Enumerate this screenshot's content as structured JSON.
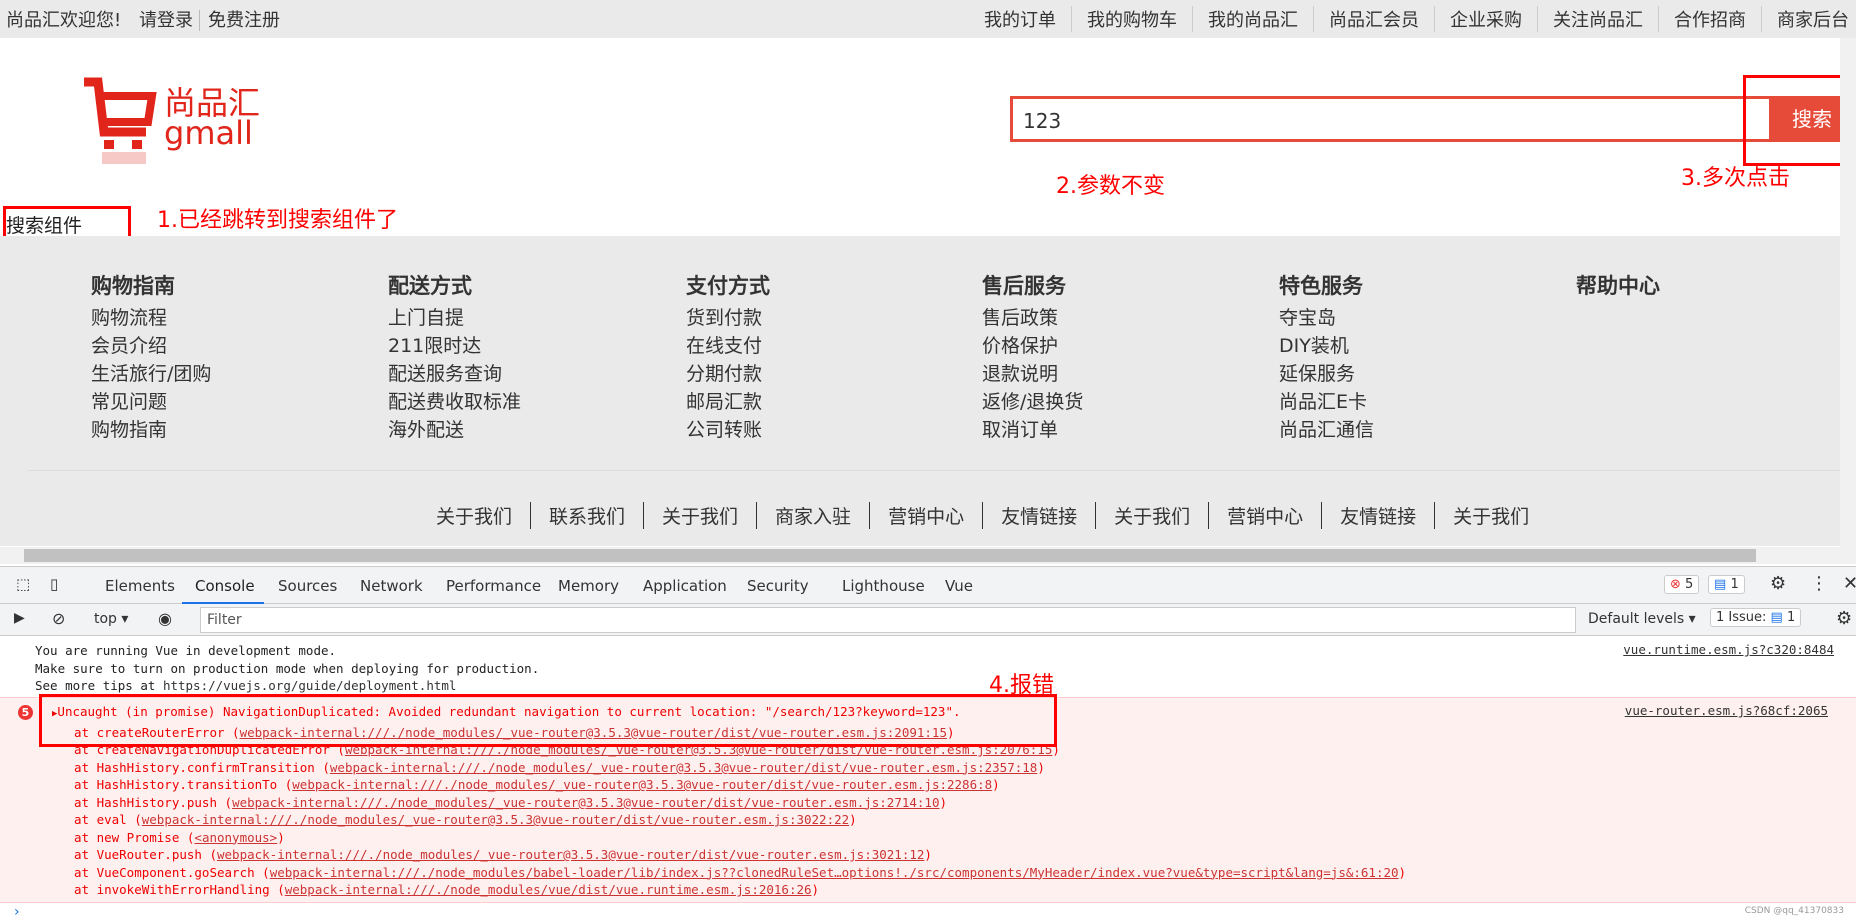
{
  "topbar": {
    "welcome": "尚品汇欢迎您!",
    "login": "请登录",
    "register": "免费注册",
    "nav": [
      "我的订单",
      "我的购物车",
      "我的尚品汇",
      "尚品汇会员",
      "企业采购",
      "关注尚品汇",
      "合作招商",
      "商家后台"
    ]
  },
  "logo": {
    "cn": "尚品汇",
    "en": "gmall"
  },
  "search": {
    "value": "123",
    "button": "搜索"
  },
  "content": {
    "component_text": "搜索组件"
  },
  "annotations": {
    "a1": "1.已经跳转到搜索组件了",
    "a2": "2.参数不变",
    "a3": "3.多次点击",
    "a4": "4.报错",
    "color": "#ff0000"
  },
  "footer": {
    "columns": [
      {
        "title": "购物指南",
        "items": [
          "购物流程",
          "会员介绍",
          "生活旅行/团购",
          "常见问题",
          "购物指南"
        ]
      },
      {
        "title": "配送方式",
        "items": [
          "上门自提",
          "211限时达",
          "配送服务查询",
          "配送费收取标准",
          "海外配送"
        ]
      },
      {
        "title": "支付方式",
        "items": [
          "货到付款",
          "在线支付",
          "分期付款",
          "邮局汇款",
          "公司转账"
        ]
      },
      {
        "title": "售后服务",
        "items": [
          "售后政策",
          "价格保护",
          "退款说明",
          "返修/退换货",
          "取消订单"
        ]
      },
      {
        "title": "特色服务",
        "items": [
          "夺宝岛",
          "DIY装机",
          "延保服务",
          "尚品汇E卡",
          "尚品汇通信"
        ]
      },
      {
        "title": "帮助中心",
        "items": []
      }
    ],
    "links": [
      "关于我们",
      "联系我们",
      "关于我们",
      "商家入驻",
      "营销中心",
      "友情链接",
      "关于我们",
      "营销中心",
      "友情链接",
      "关于我们"
    ]
  },
  "devtools": {
    "tabs": [
      "Elements",
      "Console",
      "Sources",
      "Network",
      "Performance",
      "Memory",
      "Application",
      "Security",
      "Lighthouse",
      "Vue"
    ],
    "active_tab": "Console",
    "error_count": "5",
    "message_count": "1",
    "context": "top",
    "filter_placeholder": "Filter",
    "levels": "Default levels",
    "issues": "1 Issue:",
    "issues_count": "1",
    "messages": {
      "info": [
        "You are running Vue in development mode.",
        "Make sure to turn on production mode when deploying for production.",
        "See more tips at "
      ],
      "info_link": "https://vuejs.org/guide/deployment.html",
      "info_src": "vue.runtime.esm.js?c320:8484",
      "error_count": "5",
      "error_head": "Uncaught (in promise) NavigationDuplicated: Avoided redundant navigation to current location: \"/search/123?keyword=123\".",
      "error_src": "vue-router.esm.js?68cf:2065",
      "stack": [
        {
          "fn": "at createRouterError",
          "loc": "webpack-internal:///./node_modules/_vue-router@3.5.3@vue-router/dist/vue-router.esm.js:2091:15"
        },
        {
          "fn": "at createNavigationDuplicatedError",
          "loc": "webpack-internal:///./node_modules/_vue-router@3.5.3@vue-router/dist/vue-router.esm.js:2076:15"
        },
        {
          "fn": "at HashHistory.confirmTransition",
          "loc": "webpack-internal:///./node_modules/_vue-router@3.5.3@vue-router/dist/vue-router.esm.js:2357:18"
        },
        {
          "fn": "at HashHistory.transitionTo",
          "loc": "webpack-internal:///./node_modules/_vue-router@3.5.3@vue-router/dist/vue-router.esm.js:2286:8"
        },
        {
          "fn": "at HashHistory.push",
          "loc": "webpack-internal:///./node_modules/_vue-router@3.5.3@vue-router/dist/vue-router.esm.js:2714:10"
        },
        {
          "fn": "at eval",
          "loc": "webpack-internal:///./node_modules/_vue-router@3.5.3@vue-router/dist/vue-router.esm.js:3022:22"
        },
        {
          "fn": "at new Promise",
          "loc": "<anonymous>"
        },
        {
          "fn": "at VueRouter.push",
          "loc": "webpack-internal:///./node_modules/_vue-router@3.5.3@vue-router/dist/vue-router.esm.js:3021:12"
        },
        {
          "fn": "at VueComponent.goSearch",
          "loc": "webpack-internal:///./node_modules/babel-loader/lib/index.js??clonedRuleSet…options!./src/components/MyHeader/index.vue?vue&type=script&lang=js&:61:20"
        },
        {
          "fn": "at invokeWithErrorHandling",
          "loc": "webpack-internal:///./node_modules/vue/dist/vue.runtime.esm.js:2016:26"
        }
      ]
    }
  },
  "watermark": "CSDN @qq_41370833"
}
